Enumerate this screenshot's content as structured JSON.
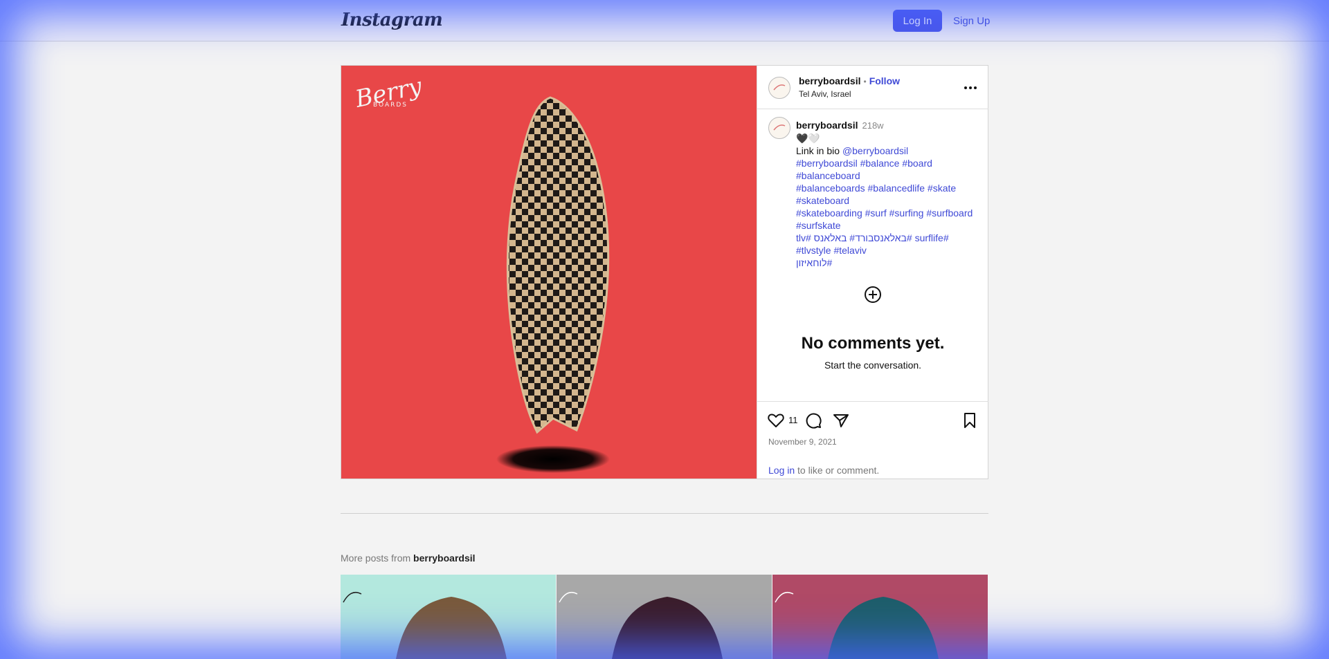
{
  "header": {
    "logo": "Instagram",
    "login_label": "Log In",
    "signup_label": "Sign Up"
  },
  "post": {
    "username": "berryboardsil",
    "follow_label": "Follow",
    "location": "Tel Aviv, Israel",
    "caption": {
      "username": "berryboardsil",
      "time": "218w",
      "hearts": "🖤🤍",
      "line1_text": "Link in bio ",
      "mention": "@berryboardsil",
      "hashtag_lines": [
        "#berryboardsil #balance #board",
        "#balanceboard",
        "#balanceboards #balancedlife #skate",
        "#skateboard",
        "#skateboarding #surf #surfing #surfboard",
        "#surfskate",
        "#surflife #באלאנסבורד# באלאנס #tlv",
        "#tlvstyle #telaviv",
        "#לוחאיזון"
      ]
    },
    "no_comments_title": "No comments yet.",
    "no_comments_sub": "Start the conversation.",
    "likes": "11",
    "date": "November 9, 2021",
    "login_link": "Log in",
    "login_rest": " to like or comment.",
    "media_logo_main": "Berry",
    "media_logo_sub": "BOARDS"
  },
  "more": {
    "prefix": "More posts from ",
    "username": "berryboardsil",
    "thumb_colors": [
      "#b3e8de",
      "#a8a8a8",
      "#b04a66"
    ]
  },
  "colors": {
    "accent": "#4a55e8",
    "link": "#3f49d6",
    "media_bg": "#e84748"
  }
}
